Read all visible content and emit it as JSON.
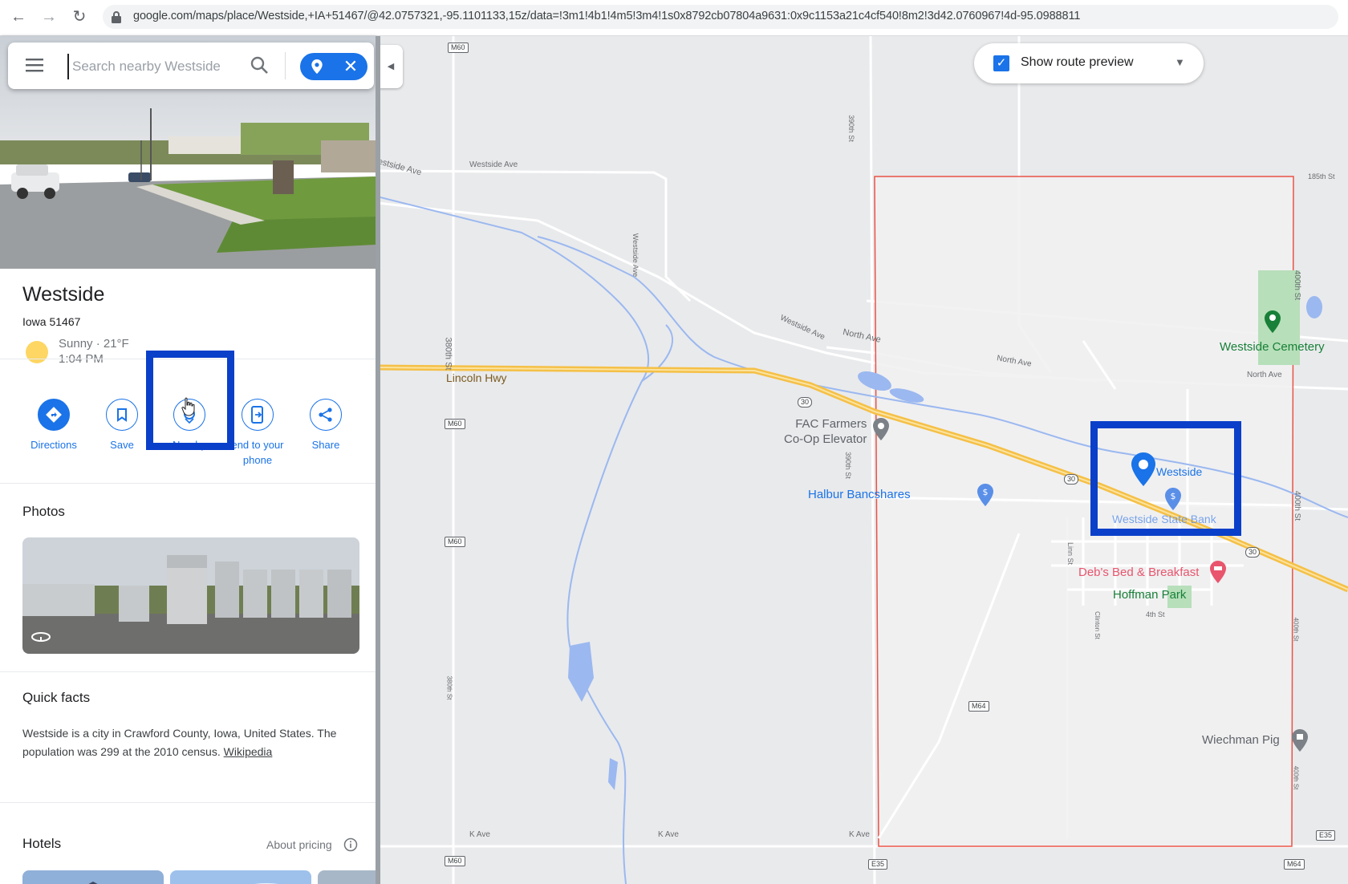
{
  "browser": {
    "url": "google.com/maps/place/Westside,+IA+51467/@42.0757321,-95.1101133,15z/data=!3m1!4b1!4m5!3m4!1s0x8792cb07804a9631:0x9c1153a21c4cf540!8m2!3d42.0760967!4d-95.0988811"
  },
  "search": {
    "placeholder": "Search nearby Westside"
  },
  "place": {
    "name": "Westside",
    "address": "Iowa 51467",
    "weather_line1": "Sunny · 21°F",
    "weather_line2": "1:04 PM"
  },
  "actions": [
    {
      "label": "Directions",
      "icon": "directions-icon"
    },
    {
      "label": "Save",
      "icon": "bookmark-icon"
    },
    {
      "label": "Nearby",
      "icon": "nearby-icon"
    },
    {
      "label": "end to your phone",
      "icon": "send-to-phone-icon"
    },
    {
      "label": "Share",
      "icon": "share-icon"
    }
  ],
  "sections": {
    "photos": "Photos",
    "quick_facts": "Quick facts",
    "facts_text": "Westside is a city in Crawford County, Iowa, United States. The population was 299 at the 2010 census.",
    "facts_link": "Wikipedia",
    "hotels": "Hotels",
    "about_pricing": "About pricing"
  },
  "map": {
    "route_preview_label": "Show route preview",
    "route_preview_checked": true,
    "places": {
      "westside": "Westside",
      "westside_state_bank": "Westside State Bank",
      "halbur": "Halbur Bancshares",
      "fac_line1": "FAC Farmers",
      "fac_line2": "Co-Op Elevator",
      "debs": "Deb's Bed & Breakfast",
      "hoffman": "Hoffman Park",
      "cemetery": "Westside Cemetery",
      "wiechman": "Wiechman Pig"
    },
    "roads": {
      "lincoln_hwy": "Lincoln Hwy",
      "westside_ave": "Westside Ave",
      "westside_ave2": "Westside Ave",
      "westside_ave_v": "Westside Ave",
      "westside_ave3": "Westside Ave",
      "north_ave": "North Ave",
      "north_ave2": "North Ave",
      "north_ave3": "North Ave",
      "st380": "380th St",
      "st380b": "380th St",
      "st390": "390th St",
      "st390b": "390th St",
      "st400": "400th St",
      "st400b": "400th St",
      "st400c": "400th St",
      "st400d": "400th St",
      "st185": "185th St",
      "linn_st": "Linn St",
      "clinton_st": "Clinton St",
      "st4th": "4th St",
      "k_ave": "K Ave",
      "k_ave2": "K Ave",
      "k_ave3": "K Ave"
    },
    "shields": {
      "m60a": "M60",
      "m60b": "M60",
      "m60c": "M60",
      "m60d": "M60",
      "us30a": "30",
      "us30b": "30",
      "us30c": "30",
      "m64a": "M64",
      "m64b": "M64",
      "e35a": "E35",
      "e35b": "E35"
    },
    "colors": {
      "highway": "#f5c046",
      "boundary": "#ea4335",
      "water": "#9bb8f0",
      "pin_blue": "#1a73e8",
      "highlight": "#0a3fc9"
    }
  }
}
